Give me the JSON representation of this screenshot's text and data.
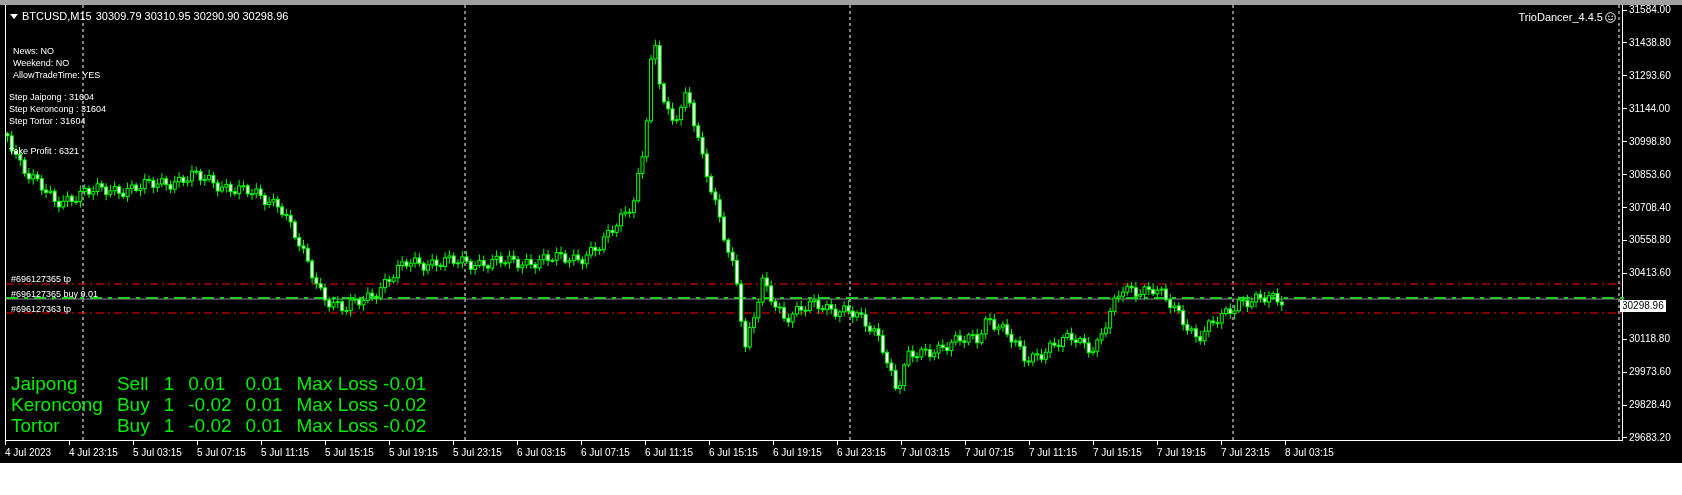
{
  "chart_header": {
    "title": "BTCUSD,M15",
    "ohlc": "30309.79 30310.95 30290.90 30298.96"
  },
  "expert_name": "TrioDancer_4.4.5",
  "status_lines": [
    "News: NO",
    "Weekend: NO",
    "AllowTradeTime: YES"
  ],
  "step_lines": [
    "Step Jaipong : 31604",
    "Step Keroncong : 31604",
    "Step Tortor : 31604"
  ],
  "take_profit": "Take Profit : 6321",
  "order_labels": [
    "#696127365 tp",
    "#696127365 buy 0.01",
    "#696127363 tp"
  ],
  "summary_rows": [
    {
      "name": "Jaipong",
      "side": "Sell",
      "count": "1",
      "profit": "0.01",
      "lot": "0.01",
      "max_loss": "Max Loss -0.01"
    },
    {
      "name": "Keroncong",
      "side": "Buy",
      "count": "1",
      "profit": "-0.02",
      "lot": "0.01",
      "max_loss": "Max Loss -0.02"
    },
    {
      "name": "Tortor",
      "side": "Buy",
      "count": "1",
      "profit": "-0.02",
      "lot": "0.01",
      "max_loss": "Max Loss -0.02"
    }
  ],
  "price_axis": {
    "labels_upper": [
      "31584.00",
      "31438.80",
      "31293.60",
      "31144.00",
      "30998.80",
      "30853.60",
      "30708.40",
      "30558.80",
      "30413.60"
    ],
    "current_price": "30298.96",
    "labels_lower": [
      "30118.80",
      "29973.60",
      "29828.40",
      "29683.20"
    ]
  },
  "time_axis": [
    "4 Jul 2023",
    "4 Jul 23:15",
    "5 Jul 03:15",
    "5 Jul 07:15",
    "5 Jul 11:15",
    "5 Jul 15:15",
    "5 Jul 19:15",
    "5 Jul 23:15",
    "6 Jul 03:15",
    "6 Jul 07:15",
    "6 Jul 11:15",
    "6 Jul 15:15",
    "6 Jul 19:15",
    "6 Jul 23:15",
    "7 Jul 03:15",
    "7 Jul 07:15",
    "7 Jul 11:15",
    "7 Jul 15:15",
    "7 Jul 19:15",
    "7 Jul 23:15",
    "8 Jul 03:15"
  ]
}
